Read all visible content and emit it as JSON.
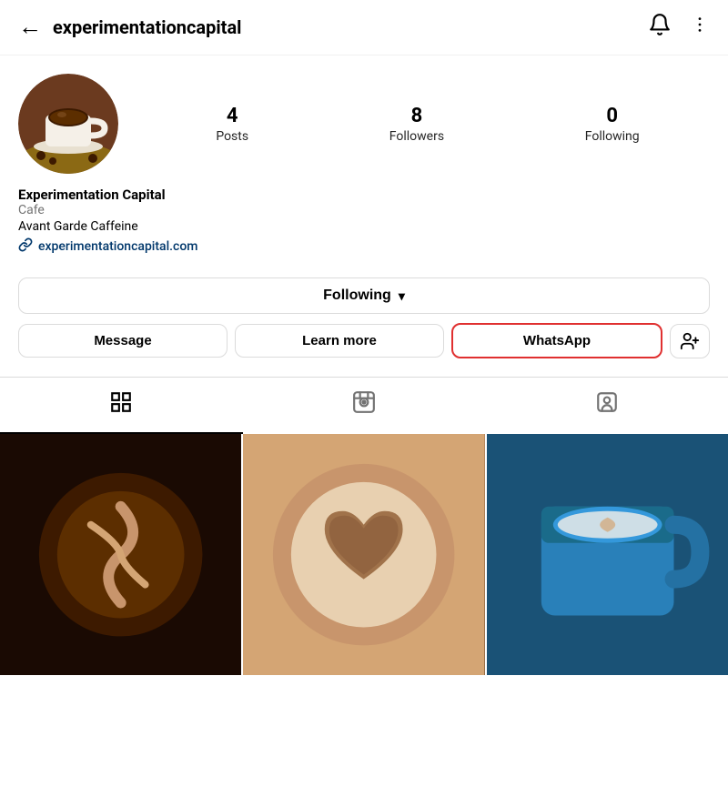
{
  "header": {
    "username": "experimentationcapital",
    "back_label": "←",
    "bell_icon": "bell-icon",
    "dots_icon": "more-icon"
  },
  "profile": {
    "name": "Experimentation Capital",
    "category": "Cafe",
    "bio": "Avant Garde Caffeine",
    "link_text": "experimentationcapital.com",
    "link_url": "https://experimentationcapital.com",
    "stats": {
      "posts_count": "4",
      "posts_label": "Posts",
      "followers_count": "8",
      "followers_label": "Followers",
      "following_count": "0",
      "following_label": "Following"
    }
  },
  "buttons": {
    "following_label": "Following",
    "message_label": "Message",
    "learn_more_label": "Learn more",
    "whatsapp_label": "WhatsApp",
    "add_friend_icon": "+"
  },
  "tabs": {
    "grid_icon": "⊞",
    "reels_icon": "▶",
    "tagged_icon": "◎"
  }
}
